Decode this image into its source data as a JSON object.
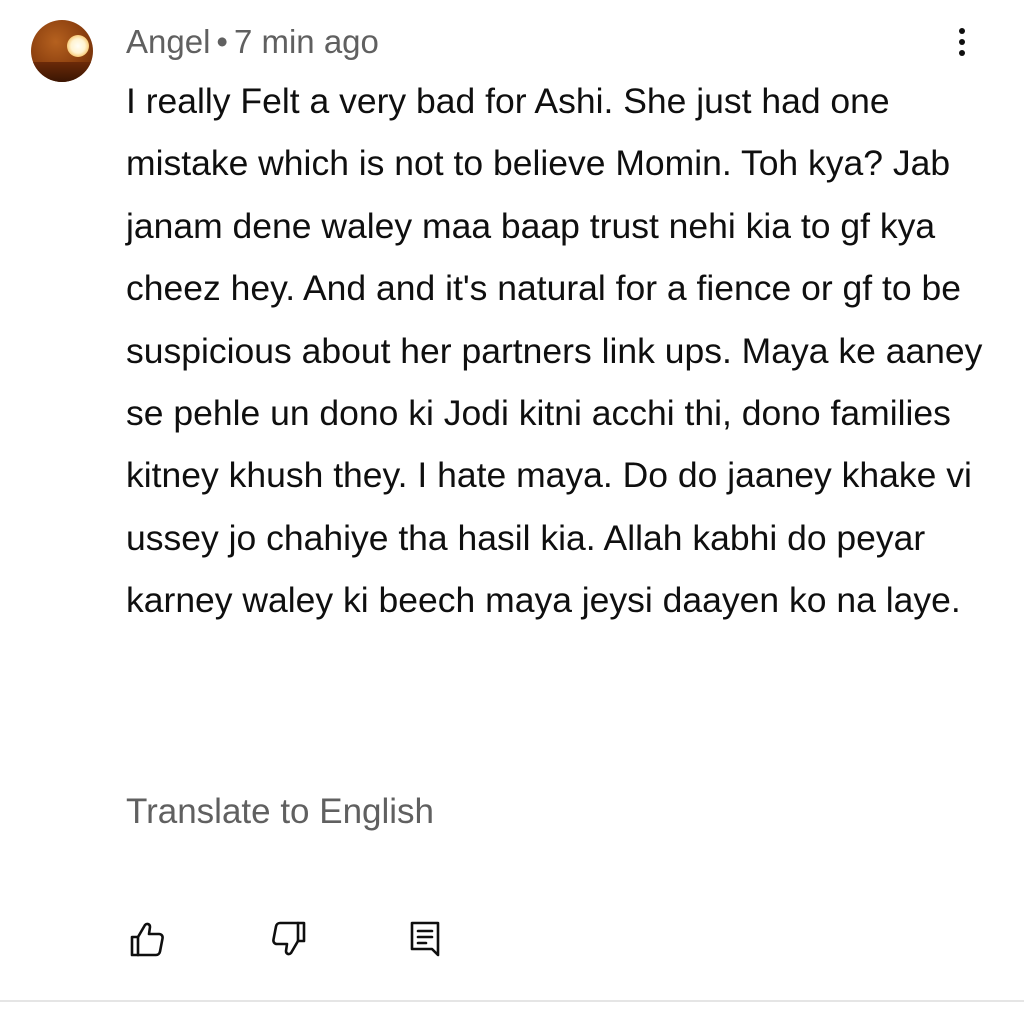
{
  "comment": {
    "author": "Angel",
    "separator": "•",
    "time": "7 min ago",
    "avatar_icon": "sunset-avatar",
    "menu_icon": "more-vertical-icon",
    "text": "I really Felt a very bad for Ashi. She just had one mistake which is not to believe Momin. Toh kya? Jab janam dene waley maa baap trust nehi kia to gf kya cheez hey. And and it's natural for a fience or gf to be suspicious about her partners link ups. Maya ke aaney se pehle un dono ki Jodi kitni acchi thi, dono families kitney khush they. I hate maya. Do do jaaney khake vi ussey jo chahiye tha hasil kia. Allah kabhi do peyar karney waley ki beech maya jeysi daayen ko na laye.",
    "translate_label": "Translate to English",
    "actions": {
      "like_icon": "thumbs-up-icon",
      "dislike_icon": "thumbs-down-icon",
      "reply_icon": "reply-comment-icon"
    }
  },
  "colors": {
    "text_primary": "#0f0f0f",
    "text_secondary": "#606060",
    "divider": "#e5e5e5",
    "background": "#ffffff"
  }
}
